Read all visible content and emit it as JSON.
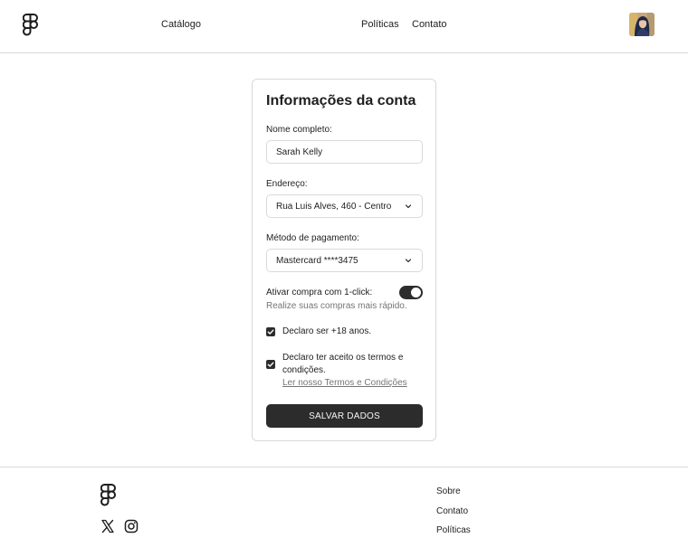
{
  "header": {
    "nav_left": "Catálogo",
    "nav_right": [
      "Políticas",
      "Contato"
    ]
  },
  "card": {
    "title": "Informações da conta",
    "name_label": "Nome completo:",
    "name_value": "Sarah Kelly",
    "address_label": "Endereço:",
    "address_value": "Rua Luis Alves, 460 - Centro",
    "payment_label": "Método de pagamento:",
    "payment_value": "Mastercard ****3475",
    "toggle_label": "Ativar compra com 1-click:",
    "toggle_help": "Realize suas compras mais rápido.",
    "toggle_on": true,
    "check_age": "Declaro ser +18 anos.",
    "check_terms": "Declaro ter aceito os termos e condições.",
    "terms_link": "Ler nosso Termos e Condições",
    "save_label": "SALVAR DADOS"
  },
  "footer": {
    "links": [
      "Sobre",
      "Contato",
      "Políticas"
    ]
  },
  "colors": {
    "primary": "#2c2c2c",
    "border": "#d9d9d9",
    "muted": "#757575"
  },
  "icons": [
    "figma-logo-icon",
    "chevron-down-icon",
    "check-icon",
    "x-twitter-icon",
    "instagram-icon"
  ]
}
